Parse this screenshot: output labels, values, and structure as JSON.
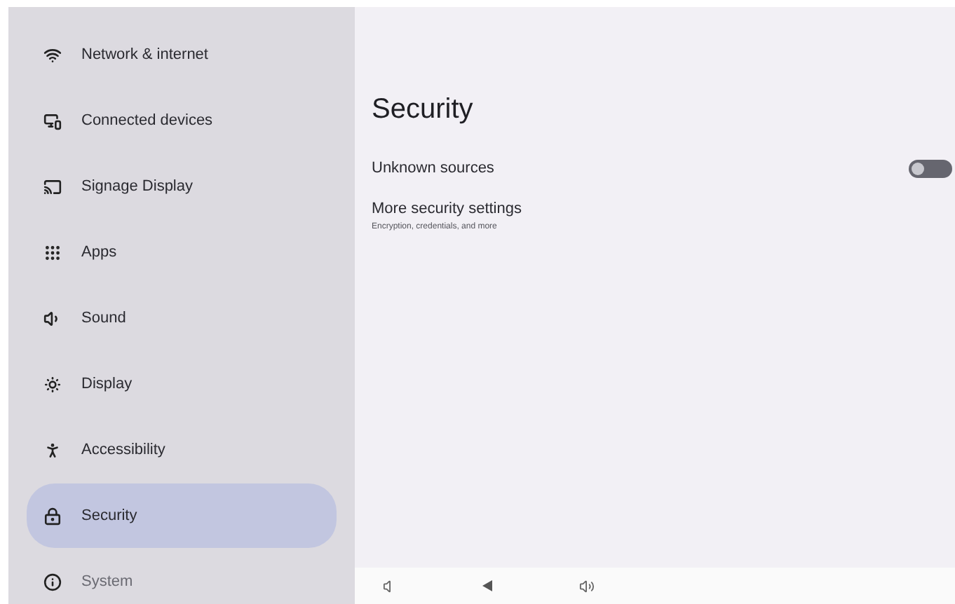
{
  "sidebar": {
    "items": [
      {
        "kind": "wifi",
        "label": "Network & internet",
        "selected": false
      },
      {
        "kind": "devices",
        "label": "Connected devices",
        "selected": false
      },
      {
        "kind": "cast",
        "label": "Signage Display",
        "selected": false
      },
      {
        "kind": "apps",
        "label": "Apps",
        "selected": false
      },
      {
        "kind": "sound",
        "label": "Sound",
        "selected": false
      },
      {
        "kind": "display",
        "label": "Display",
        "selected": false
      },
      {
        "kind": "accessibility",
        "label": "Accessibility",
        "selected": false
      },
      {
        "kind": "lock",
        "label": "Security",
        "selected": true
      },
      {
        "kind": "info",
        "label": "System",
        "selected": false
      }
    ]
  },
  "page": {
    "title": "Security",
    "settings": [
      {
        "kind": "toggle",
        "label": "Unknown sources",
        "on": false
      },
      {
        "kind": "link",
        "label": "More security settings",
        "summary": "Encryption, credentials, and more"
      }
    ]
  }
}
